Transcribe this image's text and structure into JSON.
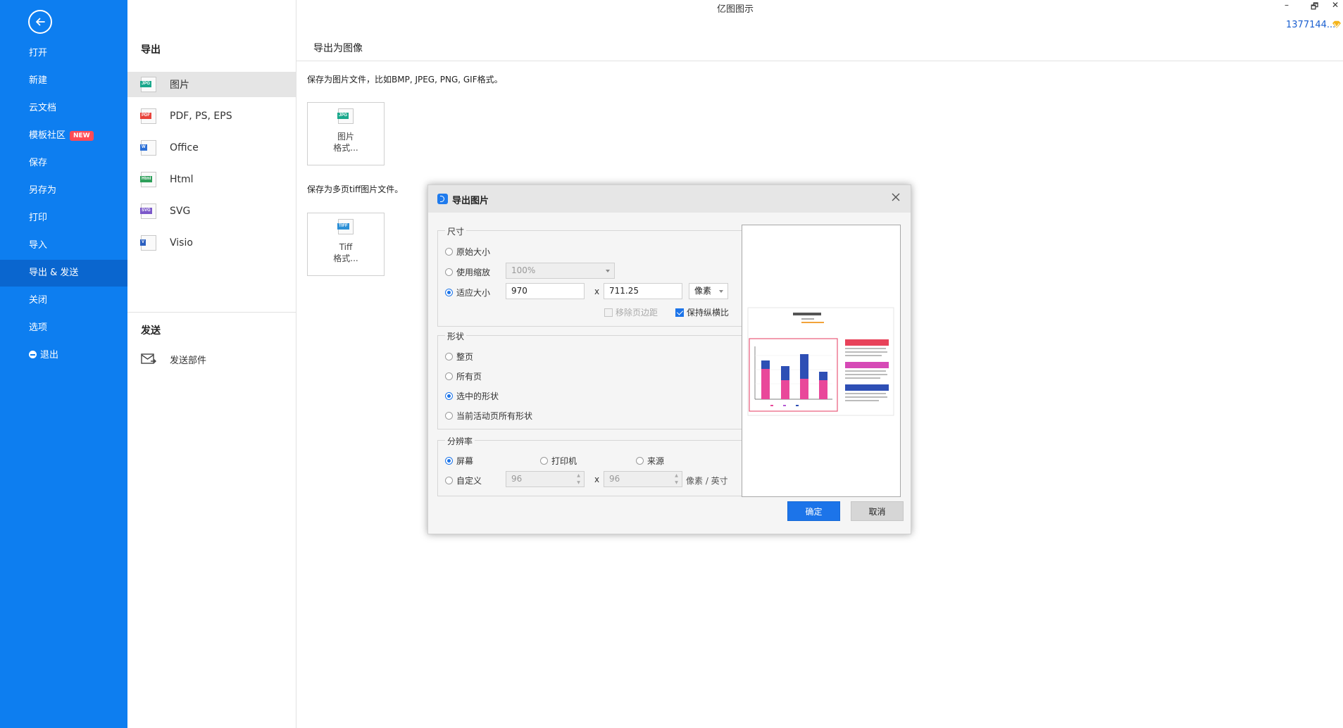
{
  "app": {
    "title": "亿图图示",
    "user_id": "1377144...",
    "minimize": "–",
    "restore": "🗗",
    "close": "✕"
  },
  "sidebar": {
    "items": [
      {
        "label": "打开"
      },
      {
        "label": "新建"
      },
      {
        "label": "云文档"
      },
      {
        "label": "模板社区",
        "badge": "NEW"
      },
      {
        "label": "保存"
      },
      {
        "label": "另存为"
      },
      {
        "label": "打印"
      },
      {
        "label": "导入"
      },
      {
        "label": "导出 & 发送"
      },
      {
        "label": "关闭"
      },
      {
        "label": "选项"
      },
      {
        "label": "退出"
      }
    ]
  },
  "export_menu": {
    "heading": "导出",
    "formats": [
      {
        "label": "图片",
        "icon": "jpg-file-icon",
        "tag": "JPG",
        "color": "#1aa88c"
      },
      {
        "label": "PDF, PS, EPS",
        "icon": "pdf-file-icon",
        "tag": "PDF",
        "color": "#e8423a"
      },
      {
        "label": "Office",
        "icon": "word-file-icon",
        "tag": "W",
        "color": "#2b6fd6"
      },
      {
        "label": "Html",
        "icon": "html-file-icon",
        "tag": "Html",
        "color": "#2e9f5a"
      },
      {
        "label": "SVG",
        "icon": "svg-file-icon",
        "tag": "SVG",
        "color": "#7b58c9"
      },
      {
        "label": "Visio",
        "icon": "visio-file-icon",
        "tag": "V",
        "color": "#2b5fc0"
      }
    ],
    "send_heading": "发送",
    "send_mail": "发送部件"
  },
  "content": {
    "title": "导出为图像",
    "image_desc": "保存为图片文件，比如BMP, JPEG, PNG, GIF格式。",
    "image_tile": {
      "line1": "图片",
      "line2": "格式...",
      "tag": "JPG"
    },
    "tiff_desc": "保存为多页tiff图片文件。",
    "tiff_tile": {
      "line1": "Tiff",
      "line2": "格式...",
      "tag": "TIFF"
    }
  },
  "dialog": {
    "title": "导出图片",
    "size": {
      "title": "尺寸",
      "original": "原始大小",
      "use_zoom": "使用缩放",
      "zoom_value": "100%",
      "fit_size": "适应大小",
      "width": "970",
      "height": "711.25",
      "unit": "像素",
      "x": "x",
      "remove_margin": "移除页边距",
      "keep_ratio": "保持纵横比"
    },
    "shape": {
      "title": "形状",
      "whole_page": "整页",
      "all_pages": "所有页",
      "selected": "选中的形状",
      "current_page_all": "当前活动页所有形状"
    },
    "resolution": {
      "title": "分辨率",
      "screen": "屏幕",
      "printer": "打印机",
      "source": "来源",
      "custom": "自定义",
      "dpi_x": "96",
      "dpi_y": "96",
      "x": "x",
      "unit": "像素 / 英寸"
    },
    "ok": "确定",
    "cancel": "取消"
  }
}
